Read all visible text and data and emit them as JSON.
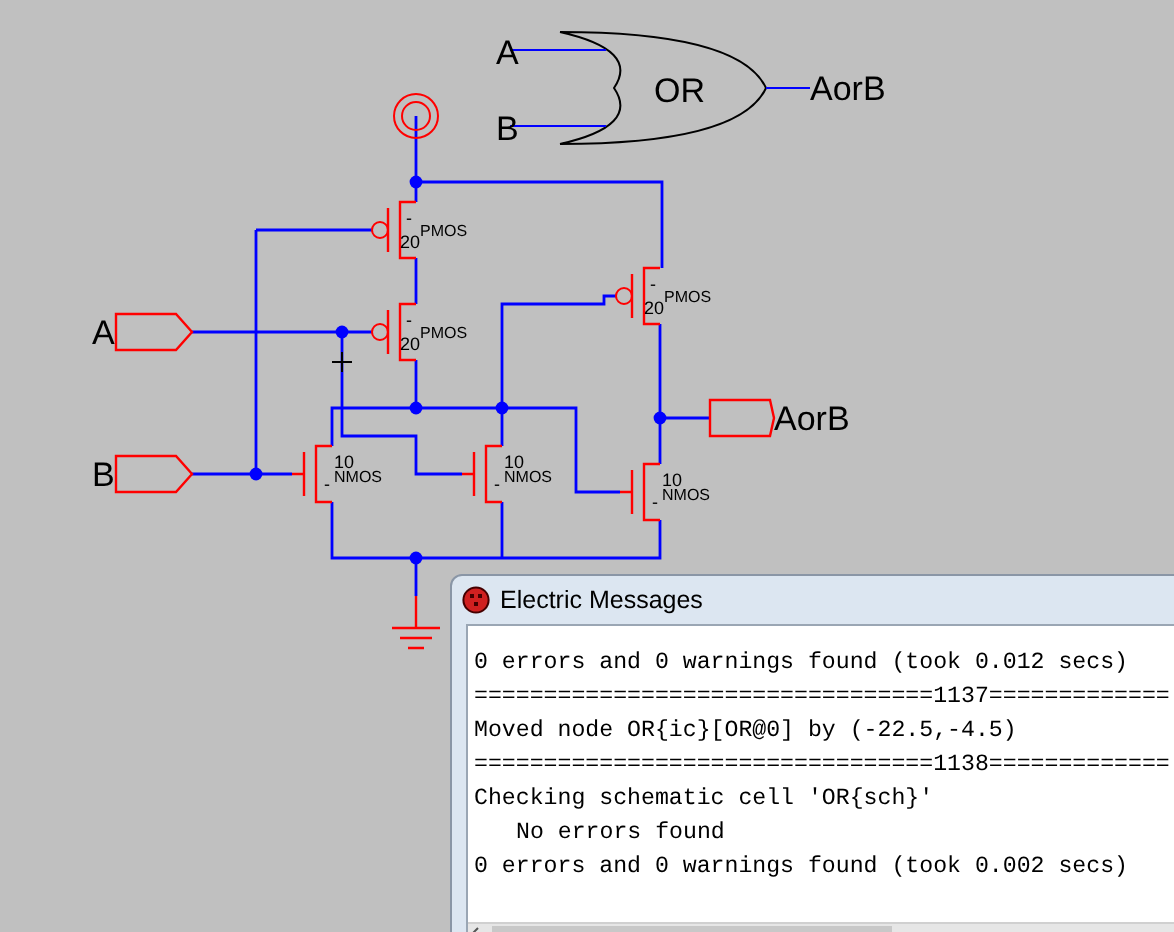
{
  "schematic": {
    "or_icon": {
      "label": "OR",
      "inputs": [
        "A",
        "B"
      ],
      "output": "AorB"
    },
    "pins": [
      {
        "kind": "input",
        "label": "A"
      },
      {
        "kind": "input",
        "label": "B"
      },
      {
        "kind": "output",
        "label": "AorB"
      }
    ],
    "transistors": [
      {
        "kind": "pmos",
        "sign": "-",
        "size": "20",
        "type": "PMOS"
      },
      {
        "kind": "pmos",
        "sign": "-",
        "size": "20",
        "type": "PMOS"
      },
      {
        "kind": "pmos",
        "sign": "-",
        "size": "20",
        "type": "PMOS"
      },
      {
        "kind": "nmos",
        "sign": "-",
        "size": "10",
        "type": "NMOS"
      },
      {
        "kind": "nmos",
        "sign": "-",
        "size": "10",
        "type": "NMOS"
      },
      {
        "kind": "nmos",
        "sign": "-",
        "size": "10",
        "type": "NMOS"
      }
    ]
  },
  "messages_window": {
    "title": "Electric Messages",
    "lines": [
      {
        "indented": false,
        "text": "0 errors and 0 warnings found (took 0.012 secs)"
      },
      {
        "indented": false,
        "text": "=================================1137============="
      },
      {
        "indented": false,
        "text": "Moved node OR{ic}[OR@0] by (-22.5,-4.5)"
      },
      {
        "indented": false,
        "text": "=================================1138============="
      },
      {
        "indented": false,
        "text": "Checking schematic cell 'OR{sch}'"
      },
      {
        "indented": true,
        "text": "No errors found"
      },
      {
        "indented": false,
        "text": "0 errors and 0 warnings found (took 0.002 secs)"
      }
    ]
  }
}
